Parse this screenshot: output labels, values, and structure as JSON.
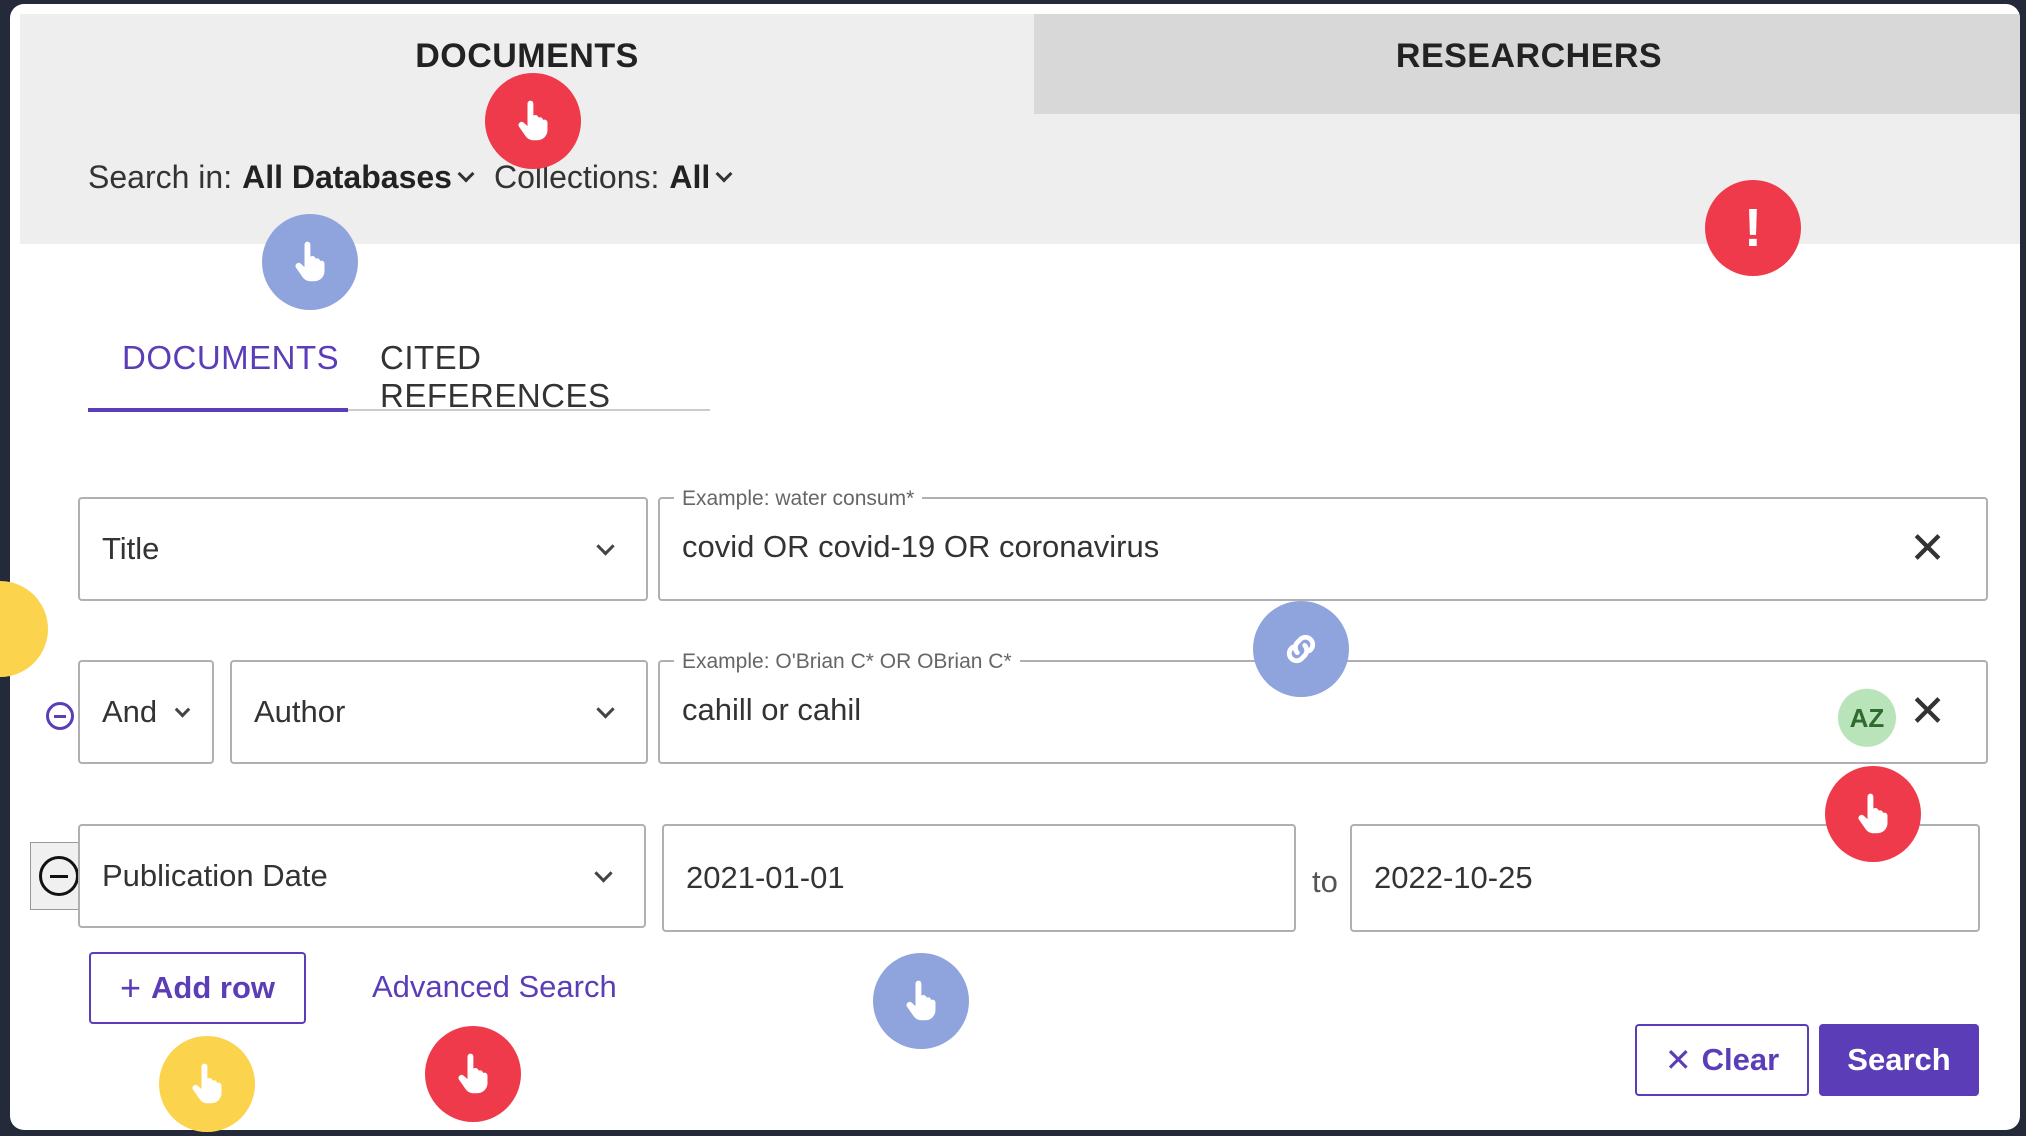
{
  "top_tabs": {
    "documents": "DOCUMENTS",
    "researchers": "RESEARCHERS"
  },
  "scope": {
    "search_in_label": "Search in:",
    "search_in_value": "All Databases",
    "collections_label": "Collections:",
    "collections_value": "All"
  },
  "sub_tabs": {
    "documents": "DOCUMENTS",
    "cited_references": "CITED REFERENCES"
  },
  "rows": {
    "row1": {
      "field": "Title",
      "legend": "Example: water consum*",
      "value": "covid OR covid-19 OR coronavirus"
    },
    "row2": {
      "operator": "And",
      "field": "Author",
      "legend": "Example: O'Brian C* OR OBrian C*",
      "value": "cahill or cahil",
      "az_badge": "AZ"
    },
    "row3": {
      "field": "Publication Date",
      "from": "2021-01-01",
      "to_label": "to",
      "to": "2022-10-25"
    }
  },
  "actions": {
    "add_row": "Add row",
    "advanced_search": "Advanced Search",
    "clear": "Clear",
    "search": "Search"
  },
  "colors": {
    "accent": "#5b3db8",
    "hint_red": "#ee3a4a",
    "hint_blue": "#8fa3dc",
    "hint_yellow": "#fcd34d"
  },
  "icons": {
    "close": "close-icon",
    "chevron": "chevron-down-icon",
    "hand": "hand-pointer-icon",
    "warning": "exclamation-icon",
    "remove_row": "minus-circle-icon"
  }
}
